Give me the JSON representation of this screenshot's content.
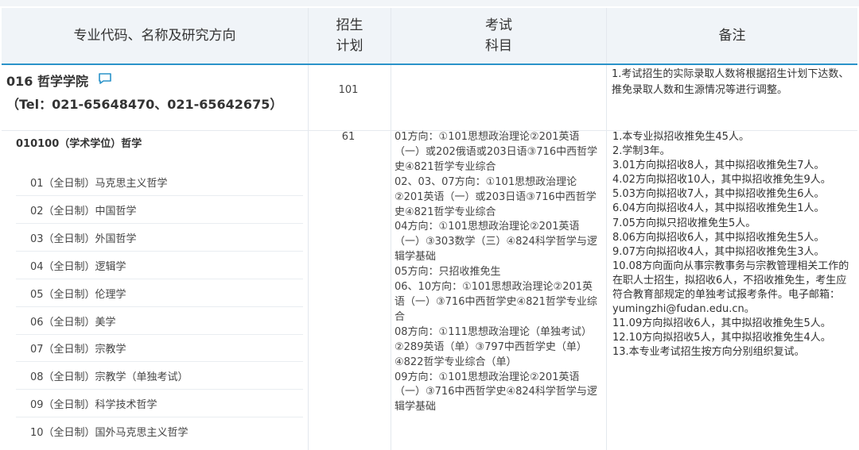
{
  "header": {
    "col1": "专业代码、名称及研究方向",
    "col2_line1": "招生",
    "col2_line2": "计划",
    "col3_line1": "考试",
    "col3_line2": "科目",
    "col4": "备注"
  },
  "college": {
    "name": "016 哲学学院",
    "tel": "（Tel：021-65648470、021-65642675）",
    "plan": "101",
    "note": "1.考试招生的实际录取人数将根据招生计划下达数、推免录取人数和生源情况等进行调整。",
    "icon": "comment-icon"
  },
  "major": {
    "title": "010100（学术学位）哲学",
    "plan": "61",
    "directions": [
      "01（全日制）马克思主义哲学",
      "02（全日制）中国哲学",
      "03（全日制）外国哲学",
      "04（全日制）逻辑学",
      "05（全日制）伦理学",
      "06（全日制）美学",
      "07（全日制）宗教学",
      "08（全日制）宗教学（单独考试）",
      "09（全日制）科学技术哲学",
      "10（全日制）国外马克思主义哲学"
    ],
    "exam": [
      "01方向：①101思想政治理论②201英语（一）或202俄语或203日语③716中西哲学史④821哲学专业综合",
      "02、03、07方向：①101思想政治理论②201英语（一）或203日语③716中西哲学史④821哲学专业综合",
      "04方向：①101思想政治理论②201英语（一）③303数学（三）④824科学哲学与逻辑学基础",
      "05方向：只招收推免生",
      "06、10方向：①101思想政治理论②201英语（一）③716中西哲学史④821哲学专业综合",
      "08方向：①111思想政治理论（单独考试）②289英语（单）③797中西哲学史（单）④822哲学专业综合（单）",
      "09方向：①101思想政治理论②201英语（一）③716中西哲学史④824科学哲学与逻辑学基础"
    ],
    "notes": [
      "1.本专业拟招收推免生45人。",
      "2.学制3年。",
      "3.01方向拟招收8人，其中拟招收推免生7人。",
      "4.02方向拟招收10人，其中拟招收推免生9人。",
      "5.03方向拟招收7人，其中拟招收推免生6人。",
      "6.04方向拟招收4人，其中拟招收推免生1人。",
      "7.05方向拟只招收推免生5人。",
      "8.06方向拟招收6人，其中拟招收推免生5人。",
      "9.07方向拟招收4人，其中拟招收推免生3人。",
      "10.08方向面向从事宗教事务与宗教管理相关工作的在职人士招生，拟招收6人，不招收推免生，考生应符合教育部规定的单独考试报考条件。电子邮箱：yumingzhi@fudan.edu.cn。",
      "11.09方向拟招收6人，其中拟招收推免生5人。",
      "12.10方向拟招收5人，其中拟招收推免生4人。",
      "13.本专业考试招生按方向分别组织复试。"
    ]
  },
  "colors": {
    "accent": "#2a93c9",
    "header_bg": "#f0f4f8"
  }
}
